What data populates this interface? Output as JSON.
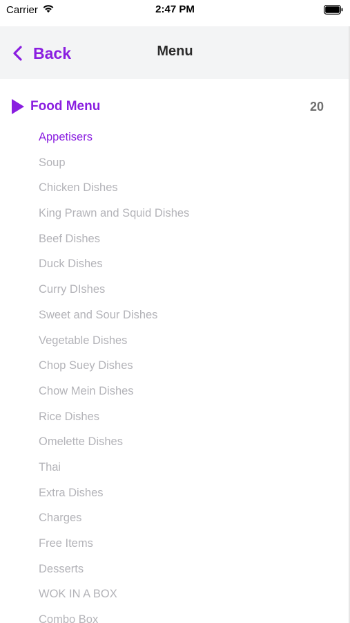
{
  "status_bar": {
    "carrier": "Carrier",
    "time": "2:47 PM",
    "icons": [
      "wifi-icon",
      "battery-icon"
    ]
  },
  "nav": {
    "back_label": "Back",
    "back_icon": "chevron-left-icon",
    "title": "Menu"
  },
  "section": {
    "icon": "play-icon",
    "title": "Food Menu",
    "count": "20"
  },
  "categories": [
    {
      "label": "Appetisers",
      "active": true
    },
    {
      "label": "Soup",
      "active": false
    },
    {
      "label": "Chicken Dishes",
      "active": false
    },
    {
      "label": "King Prawn and Squid Dishes",
      "active": false
    },
    {
      "label": "Beef Dishes",
      "active": false
    },
    {
      "label": "Duck Dishes",
      "active": false
    },
    {
      "label": "Curry DIshes",
      "active": false
    },
    {
      "label": "Sweet and Sour Dishes",
      "active": false
    },
    {
      "label": "Vegetable Dishes",
      "active": false
    },
    {
      "label": "Chop Suey Dishes",
      "active": false
    },
    {
      "label": "Chow Mein Dishes",
      "active": false
    },
    {
      "label": "Rice Dishes",
      "active": false
    },
    {
      "label": "Omelette Dishes",
      "active": false
    },
    {
      "label": "Thai",
      "active": false
    },
    {
      "label": "Extra Dishes",
      "active": false
    },
    {
      "label": "Charges",
      "active": false
    },
    {
      "label": "Free Items",
      "active": false
    },
    {
      "label": "Desserts",
      "active": false
    },
    {
      "label": "WOK IN A BOX",
      "active": false
    },
    {
      "label": "Combo Box",
      "active": false
    }
  ],
  "colors": {
    "accent": "#8a1ee0",
    "inactive_text": "#b3b3b8",
    "nav_background": "#f3f4f5",
    "count_text": "#6f6f6f"
  }
}
